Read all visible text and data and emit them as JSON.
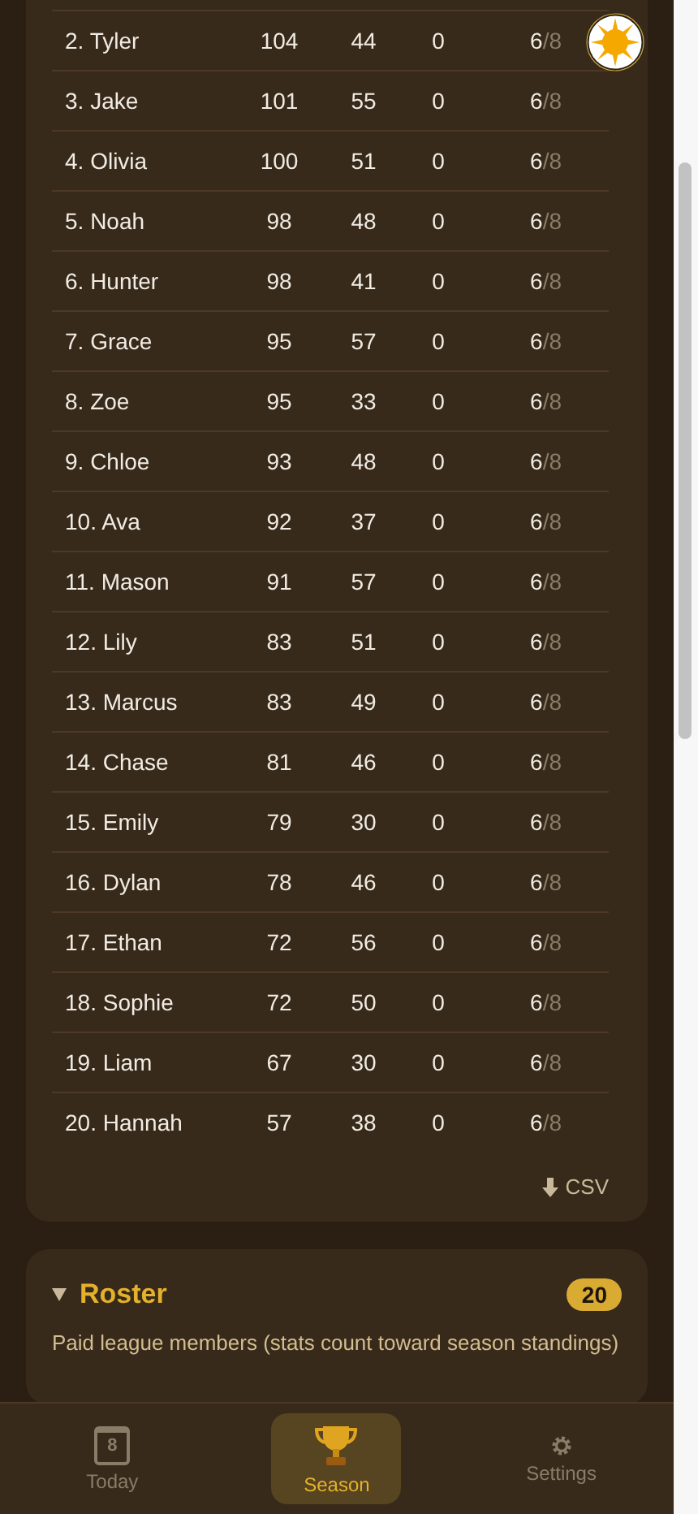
{
  "standings": {
    "rows": [
      {
        "name": "2. Tyler",
        "c1": "104",
        "c2": "44",
        "c3": "0",
        "done": "6",
        "total": "/8"
      },
      {
        "name": "3. Jake",
        "c1": "101",
        "c2": "55",
        "c3": "0",
        "done": "6",
        "total": "/8"
      },
      {
        "name": "4. Olivia",
        "c1": "100",
        "c2": "51",
        "c3": "0",
        "done": "6",
        "total": "/8"
      },
      {
        "name": "5. Noah",
        "c1": "98",
        "c2": "48",
        "c3": "0",
        "done": "6",
        "total": "/8"
      },
      {
        "name": "6. Hunter",
        "c1": "98",
        "c2": "41",
        "c3": "0",
        "done": "6",
        "total": "/8"
      },
      {
        "name": "7. Grace",
        "c1": "95",
        "c2": "57",
        "c3": "0",
        "done": "6",
        "total": "/8"
      },
      {
        "name": "8. Zoe",
        "c1": "95",
        "c2": "33",
        "c3": "0",
        "done": "6",
        "total": "/8"
      },
      {
        "name": "9. Chloe",
        "c1": "93",
        "c2": "48",
        "c3": "0",
        "done": "6",
        "total": "/8"
      },
      {
        "name": "10. Ava",
        "c1": "92",
        "c2": "37",
        "c3": "0",
        "done": "6",
        "total": "/8"
      },
      {
        "name": "11. Mason",
        "c1": "91",
        "c2": "57",
        "c3": "0",
        "done": "6",
        "total": "/8"
      },
      {
        "name": "12. Lily",
        "c1": "83",
        "c2": "51",
        "c3": "0",
        "done": "6",
        "total": "/8"
      },
      {
        "name": "13. Marcus",
        "c1": "83",
        "c2": "49",
        "c3": "0",
        "done": "6",
        "total": "/8"
      },
      {
        "name": "14. Chase",
        "c1": "81",
        "c2": "46",
        "c3": "0",
        "done": "6",
        "total": "/8"
      },
      {
        "name": "15. Emily",
        "c1": "79",
        "c2": "30",
        "c3": "0",
        "done": "6",
        "total": "/8"
      },
      {
        "name": "16. Dylan",
        "c1": "78",
        "c2": "46",
        "c3": "0",
        "done": "6",
        "total": "/8"
      },
      {
        "name": "17. Ethan",
        "c1": "72",
        "c2": "56",
        "c3": "0",
        "done": "6",
        "total": "/8"
      },
      {
        "name": "18. Sophie",
        "c1": "72",
        "c2": "50",
        "c3": "0",
        "done": "6",
        "total": "/8"
      },
      {
        "name": "19. Liam",
        "c1": "67",
        "c2": "30",
        "c3": "0",
        "done": "6",
        "total": "/8"
      },
      {
        "name": "20. Hannah",
        "c1": "57",
        "c2": "38",
        "c3": "0",
        "done": "6",
        "total": "/8"
      }
    ],
    "export": "CSV"
  },
  "roster": {
    "title": "Roster",
    "expanded": true,
    "count": "20",
    "description": "Paid league members (stats count toward season standings)"
  },
  "nav": [
    {
      "kind": "today",
      "label": "Today",
      "day": "8",
      "selected": false
    },
    {
      "kind": "season",
      "label": "Season",
      "selected": true
    },
    {
      "kind": "settings",
      "label": "Settings",
      "selected": false
    }
  ]
}
